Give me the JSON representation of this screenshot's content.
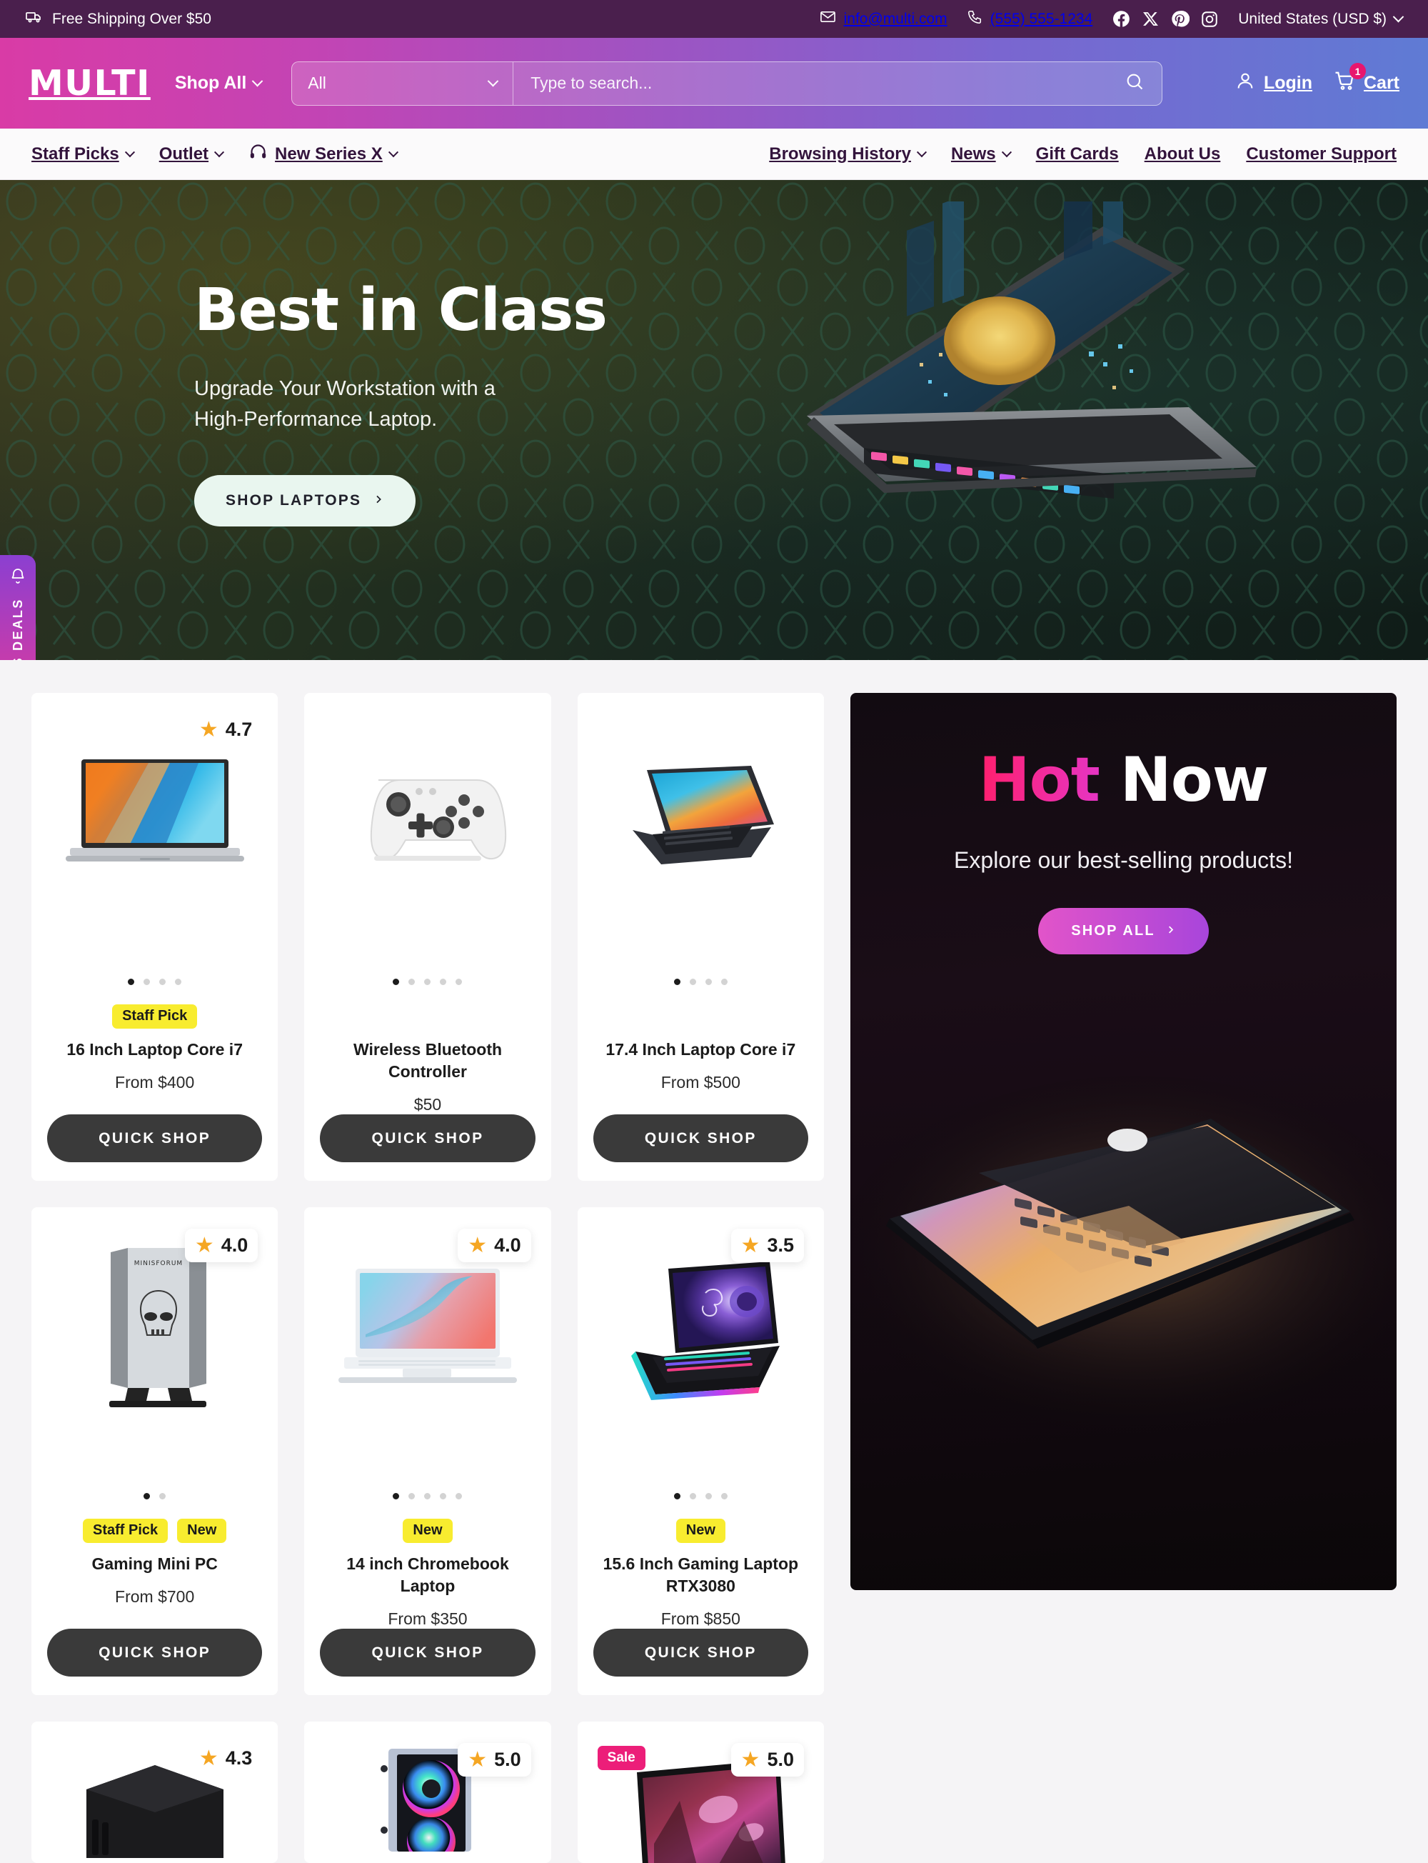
{
  "topbar": {
    "shipping_icon": "truck-icon",
    "shipping_text": "Free Shipping Over $50",
    "email_icon": "mail-icon",
    "email": "info@multi.com",
    "phone_icon": "phone-icon",
    "phone": "(555) 555-1234",
    "socials": [
      "facebook-icon",
      "x-twitter-icon",
      "pinterest-icon",
      "instagram-icon"
    ],
    "locale": "United States (USD $)",
    "locale_chevron": "chevron-down-icon"
  },
  "header": {
    "logo": "MULTI",
    "shop_all": "Shop All",
    "shop_all_chevron": "chevron-down-icon",
    "search_category": "All",
    "search_category_chevron": "chevron-down-icon",
    "search_placeholder": "Type to search...",
    "search_value": "",
    "search_icon": "search-icon",
    "account_icon": "user-icon",
    "login": "Login",
    "cart_icon": "cart-icon",
    "cart": "Cart",
    "cart_count": "1"
  },
  "nav": {
    "left": [
      {
        "label": "Staff Picks",
        "chevron": true,
        "icon": null
      },
      {
        "label": "Outlet",
        "chevron": true,
        "icon": null
      },
      {
        "label": "New Series X",
        "chevron": true,
        "icon": "headphones-icon"
      }
    ],
    "right": [
      {
        "label": "Browsing History",
        "chevron": true
      },
      {
        "label": "News",
        "chevron": true
      },
      {
        "label": "Gift Cards",
        "chevron": false
      },
      {
        "label": "About Us",
        "chevron": false
      },
      {
        "label": "Customer Support",
        "chevron": false
      }
    ]
  },
  "hero": {
    "title": "Best in Class",
    "subtitle": "Upgrade Your Workstation with a High-Performance Laptop.",
    "cta": "SHOP LAPTOPS",
    "cta_arrow": "chevron-right-icon",
    "deals_tab": "TODAY'S DEALS",
    "deals_icon": "bell-icon"
  },
  "promo": {
    "title_hot": "Hot",
    "title_now": " Now",
    "subtitle": "Explore our best-selling products!",
    "cta": "SHOP ALL",
    "cta_arrow": "chevron-right-icon"
  },
  "products": [
    {
      "title": "16 Inch Laptop Core i7",
      "price": "From $400",
      "rating": "4.7",
      "rating_style": "flat",
      "badges": [
        "Staff Pick"
      ],
      "sale": null,
      "dots": 4,
      "active_dot": 0,
      "quick_shop": "QUICK SHOP",
      "image": "silver-laptop-orange-blue-wallpaper"
    },
    {
      "title": "Wireless Bluetooth Controller",
      "price": "$50",
      "rating": null,
      "rating_style": null,
      "badges": [],
      "sale": null,
      "dots": 5,
      "active_dot": 0,
      "quick_shop": "QUICK SHOP",
      "image": "white-game-controller"
    },
    {
      "title": "17.4 Inch Laptop Core i7",
      "price": "From $500",
      "rating": null,
      "rating_style": null,
      "badges": [],
      "sale": null,
      "dots": 4,
      "active_dot": 0,
      "quick_shop": "QUICK SHOP",
      "image": "dark-laptop-colorful-wallpaper"
    },
    {
      "title": "Gaming Mini PC",
      "price": "From $700",
      "rating": "4.0",
      "rating_style": "card",
      "badges": [
        "Staff Pick",
        "New"
      ],
      "sale": null,
      "dots": 2,
      "active_dot": 0,
      "quick_shop": "QUICK SHOP",
      "image": "minisforum-skull-mini-pc"
    },
    {
      "title": "14 inch Chromebook Laptop",
      "price": "From $350",
      "rating": "4.0",
      "rating_style": "card",
      "badges": [
        "New"
      ],
      "sale": null,
      "dots": 5,
      "active_dot": 0,
      "quick_shop": "QUICK SHOP",
      "image": "white-chromebook-gradient-screen"
    },
    {
      "title": "15.6 Inch Gaming Laptop RTX3080",
      "price": "From $850",
      "rating": "3.5",
      "rating_style": "card",
      "badges": [
        "New"
      ],
      "sale": null,
      "dots": 4,
      "active_dot": 0,
      "quick_shop": "QUICK SHOP",
      "image": "msi-gaming-laptop-purple-vortex"
    },
    {
      "title": "",
      "price": "",
      "rating": "4.3",
      "rating_style": "flat",
      "badges": [],
      "sale": null,
      "dots": 0,
      "active_dot": 0,
      "quick_shop": "",
      "image": "black-mini-pc-tower"
    },
    {
      "title": "",
      "price": "",
      "rating": "5.0",
      "rating_style": "card",
      "badges": [],
      "sale": null,
      "dots": 0,
      "active_dot": 0,
      "quick_shop": "",
      "image": "rgb-fan-pc-case"
    },
    {
      "title": "",
      "price": "",
      "rating": "5.0",
      "rating_style": "card",
      "badges": [],
      "sale": "Sale",
      "dots": 0,
      "active_dot": 0,
      "quick_shop": "",
      "image": "gaming-monitor-purple-artwork"
    }
  ],
  "colors": {
    "topbar_bg": "#4a1f4d",
    "header_gradient_start": "#d93ba6",
    "header_gradient_end": "#5f7bd4",
    "badge_yellow": "#f8ec2f",
    "sale_pink": "#ec1e79",
    "star_gold": "#f5a623",
    "quick_shop_bg": "#3a3a3a",
    "cart_badge": "#e8166e"
  }
}
